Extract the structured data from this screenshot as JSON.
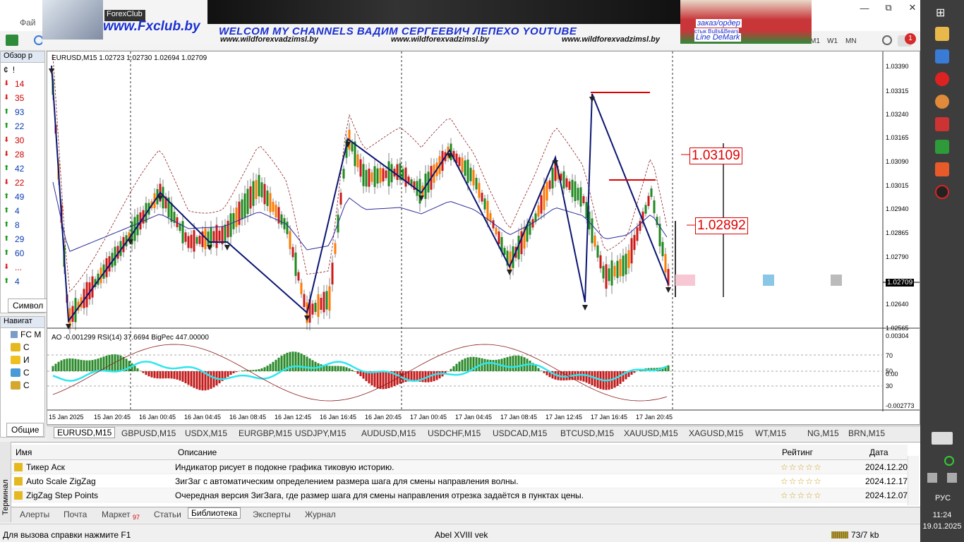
{
  "window": {
    "menu_first": "Фай",
    "buttons": [
      "—",
      "⧉",
      "✕"
    ]
  },
  "toolbar": {
    "timeframes": [
      "M1",
      "W1",
      "MN"
    ],
    "notif_count": "1"
  },
  "banner": {
    "brand_small": "ForexClub",
    "brand": "www.Fxclub.by",
    "welcome": "WELCOM MY CHANNELS ВАДИМ СЕРГЕЕВИЧ ЛЕПЕХО YOUTUBE",
    "site1": "www.wildforexvadzimsl.by",
    "site2": "www.wildforexvadzimsl.by",
    "site3": "www.wildforexvadzimsl.by",
    "order": "заказ/ордер",
    "bulls": "стык Bulls&Bears",
    "demark": "Line DeMark"
  },
  "market_watch": {
    "title": "Обзор р",
    "cols": [
      "¢",
      "!"
    ],
    "values": [
      "14",
      "35",
      "93",
      "22",
      "30",
      "28",
      "42",
      "22",
      "49",
      "4",
      "8",
      "29",
      "60",
      "...",
      "4"
    ],
    "dirs": [
      "d",
      "d",
      "u",
      "u",
      "d",
      "d",
      "u",
      "d",
      "u",
      "u",
      "u",
      "u",
      "u",
      "d",
      "u"
    ],
    "tab": "Символ"
  },
  "navigator": {
    "title": "Навигат",
    "root": "FC M",
    "items": [
      "C",
      "И",
      "C",
      "C"
    ],
    "tab": "Общие"
  },
  "chart": {
    "symbol_info": "EURUSD,M15  1.02723 1.02730 1.02694 1.02709",
    "indicator_info": "AO -0.001299  RSI(14) 37.6694  BigPec 447.00000",
    "current_price": "1.02709",
    "label_high": "1.03109",
    "label_low": "1.02892",
    "price_axis": [
      "1.03390",
      "1.03315",
      "1.03240",
      "1.03165",
      "1.03090",
      "1.03015",
      "1.02940",
      "1.02865",
      "1.02790",
      "1.02640",
      "1.02565"
    ],
    "sub_axis": [
      "0.00304",
      "70",
      "50",
      "0.00",
      "30",
      "-0.002773"
    ],
    "time_axis": [
      "15 Jan 2025",
      "15 Jan 20:45",
      "16 Jan 00:45",
      "16 Jan 04:45",
      "16 Jan 08:45",
      "16 Jan 12:45",
      "16 Jan 16:45",
      "16 Jan 20:45",
      "17 Jan 00:45",
      "17 Jan 04:45",
      "17 Jan 08:45",
      "17 Jan 12:45",
      "17 Jan 16:45",
      "17 Jan 20:45"
    ]
  },
  "symbol_tabs": [
    "EURUSD,M15",
    "GBPUSD,M15",
    "USDX,M15",
    "EURGBP,M15",
    "USDJPY,M15",
    "AUDUSD,M15",
    "USDCHF,M15",
    "USDCAD,M15",
    "BTCUSD,M15",
    "XAUUSD,M15",
    "XAGUSD,M15",
    "WT,M15",
    "NG,M15",
    "BRN,M15"
  ],
  "library": {
    "headers": {
      "name": "Имя",
      "desc": "Описание",
      "rating": "Рейтинг",
      "date": "Дата"
    },
    "rows": [
      {
        "name": "Тикер Аск",
        "desc": "Индикатор рисует в подокне графика тиковую историю.",
        "date": "2024.12.20"
      },
      {
        "name": "Auto Scale ZigZag",
        "desc": "ЗигЗаг с автоматическим определением размера шага для смены направления волны.",
        "date": "2024.12.17"
      },
      {
        "name": "ZigZag Step Points",
        "desc": "Очередная версия ЗигЗага, где размер шага для смены направления отрезка задаётся в пунктах цены.",
        "date": "2024.12.07"
      }
    ]
  },
  "terminal": {
    "label": "Терминал",
    "tabs": [
      "Алерты",
      "Почта",
      "Маркет",
      "Статьи",
      "Библиотека",
      "Эксперты",
      "Журнал"
    ],
    "market_badge": "97"
  },
  "status": {
    "help": "Для вызова справки нажмите F1",
    "profile": "Abel XVIII vek",
    "traffic": "73/7 kb"
  },
  "taskbar": {
    "lang": "РУС",
    "time": "11:24",
    "date": "19.01.2025"
  }
}
